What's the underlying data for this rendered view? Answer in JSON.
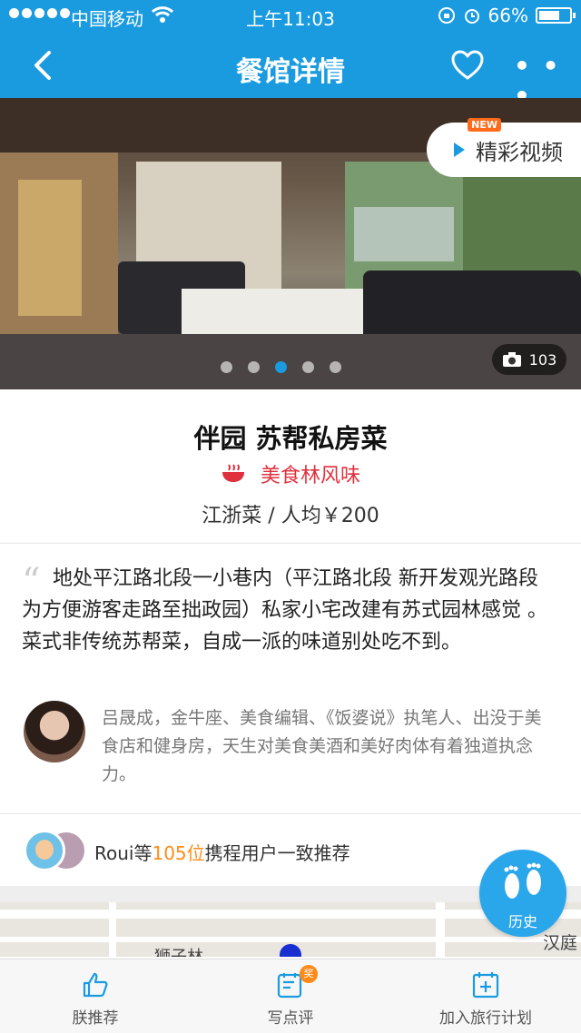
{
  "status_bar": {
    "carrier": "中国移动",
    "time": "上午11:03",
    "battery": "66%"
  },
  "nav": {
    "title": "餐馆详情"
  },
  "hero": {
    "video_badge": "NEW",
    "video_label": "精彩视频",
    "photo_count": "103",
    "page_total": 5,
    "page_active": 3
  },
  "restaurant": {
    "name": "伴园 苏帮私房菜",
    "tag": "美食林风味",
    "cuisine_price": "江浙菜 / 人均￥200"
  },
  "review": {
    "quote": "地处平江路北段一小巷内（平江路北段 新开发观光路段 为方便游客走路至拙政园）私家小宅改建有苏式园林感觉 。菜式非传统苏帮菜，自成一派的味道别处吃不到。",
    "author_bio": "吕晟成，金牛座、美食编辑、《饭婆说》执笔人、出没于美食店和健身房，天生对美食美酒和美好肉体有着独道执念力。"
  },
  "recommend": {
    "prefix": "Roui等",
    "count": "105位",
    "suffix": "携程用户一致推荐"
  },
  "map": {
    "label_lion": "狮子林",
    "label_han": "汉庭"
  },
  "history_button": {
    "label": "历史"
  },
  "tabbar": {
    "recommend": "朕推荐",
    "write_review": "写点评",
    "review_badge": "奖",
    "add_plan": "加入旅行计划"
  }
}
